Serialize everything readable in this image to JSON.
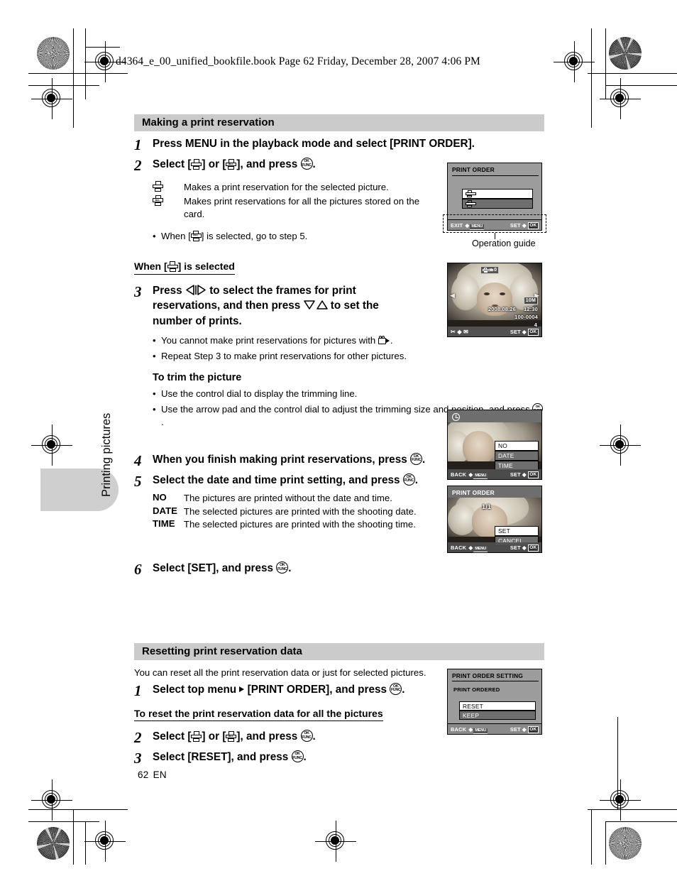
{
  "running_head": "d4364_e_00_unified_bookfile.book  Page 62  Friday, December 28, 2007  4:06 PM",
  "side_tab": {
    "label": "Printing pictures"
  },
  "page_footer": {
    "number": "62",
    "lang": "EN"
  },
  "sections": [
    {
      "heading": "Making a print reservation",
      "steps": [
        {
          "num": "1",
          "text_before": "Press MENU in the playback mode and select [PRINT ORDER]."
        },
        {
          "num": "2",
          "text_before": "Select [",
          "text_mid": "] or [",
          "text_after": "], and press"
        }
      ],
      "icon_defs": [
        {
          "icon": "printer-single-icon",
          "text": "Makes a print reservation for the selected picture."
        },
        {
          "icon": "printer-all-icon",
          "text": "Makes print reservations for all the pictures stored on the card."
        }
      ],
      "note": {
        "prefix": "When [",
        "suffix": "] is selected, go to step 5."
      }
    },
    {
      "subheading_when": {
        "prefix": "When [",
        "suffix": "] is selected"
      },
      "step3": {
        "num": "3",
        "line1_a": "Press",
        "line1_b": "to select the frames for print",
        "line2_a": "reservations, and then press",
        "line2_b": "to set the",
        "line3": "number of prints."
      },
      "step3_bullets": [
        {
          "prefix": "You cannot make print reservations for pictures with",
          "suffix": "."
        },
        {
          "prefix": "Repeat Step 3 to make print reservations for other pictures.",
          "suffix": ""
        }
      ],
      "trim_heading": "To trim the picture",
      "trim_bullets": [
        {
          "prefix": "Use the control dial to display the trimming line.",
          "suffix": ""
        },
        {
          "prefix": "Use the arrow pad and the control dial to adjust the trimming size and position, and press",
          "suffix": "."
        }
      ],
      "step4": {
        "num": "4",
        "text": "When you finish making print reservations, press"
      },
      "step5": {
        "num": "5",
        "text": "Select the date and time print setting, and press"
      },
      "step5_defs": [
        {
          "key": "NO",
          "value": "The pictures are printed without the date and time."
        },
        {
          "key": "DATE",
          "value": "The selected pictures are printed with the shooting date."
        },
        {
          "key": "TIME",
          "value": "The selected pictures are printed with the shooting time."
        }
      ],
      "step6": {
        "num": "6",
        "text": "Select [SET], and press"
      }
    },
    {
      "heading": "Resetting print reservation data",
      "intro": "You can reset all the print reservation data or just for selected pictures.",
      "step1": {
        "num": "1",
        "text_a": "Select top menu",
        "text_b": "[PRINT ORDER], and press"
      },
      "subheading": "To reset the print reservation data for all the pictures",
      "step2": {
        "num": "2",
        "text_before": "Select [",
        "text_mid": "] or [",
        "text_after": "], and press"
      },
      "step3": {
        "num": "3",
        "text": "Select [RESET], and press"
      }
    }
  ],
  "screens": {
    "print_order_1": {
      "title": "PRINT ORDER",
      "options": [
        {
          "label": "printer-single-icon",
          "selected": true
        },
        {
          "label": "printer-all-icon",
          "selected": false
        }
      ],
      "guide_left": "EXIT",
      "guide_left_key": "MENU",
      "guide_right": "SET",
      "guide_right_key": "OK",
      "callout": "Operation guide"
    },
    "playback": {
      "print_count_label": "x",
      "print_count": "0",
      "size_badge": "10M",
      "date": "2008.08.26",
      "time": "12:30",
      "file_no": "100-0004",
      "frame_count": "4",
      "guide_right": "SET",
      "guide_right_key": "OK"
    },
    "date_time": {
      "options": [
        {
          "label": "NO",
          "selected": true
        },
        {
          "label": "DATE",
          "selected": false
        },
        {
          "label": "TIME",
          "selected": false
        }
      ],
      "guide_left": "BACK",
      "guide_left_key": "MENU",
      "guide_right": "SET",
      "guide_right_key": "OK"
    },
    "print_order_2": {
      "title": "PRINT ORDER",
      "counter": "1/1",
      "options": [
        {
          "label": "SET",
          "selected": true
        },
        {
          "label": "CANCEL",
          "selected": false
        }
      ],
      "guide_left": "BACK",
      "guide_left_key": "MENU",
      "guide_right": "SET",
      "guide_right_key": "OK"
    },
    "print_order_setting": {
      "title": "PRINT ORDER SETTING",
      "subtitle": "PRINT ORDERED",
      "options": [
        {
          "label": "RESET",
          "selected": true
        },
        {
          "label": "KEEP",
          "selected": false
        }
      ],
      "guide_left": "BACK",
      "guide_left_key": "MENU",
      "guide_right": "SET",
      "guide_right_key": "OK"
    }
  }
}
